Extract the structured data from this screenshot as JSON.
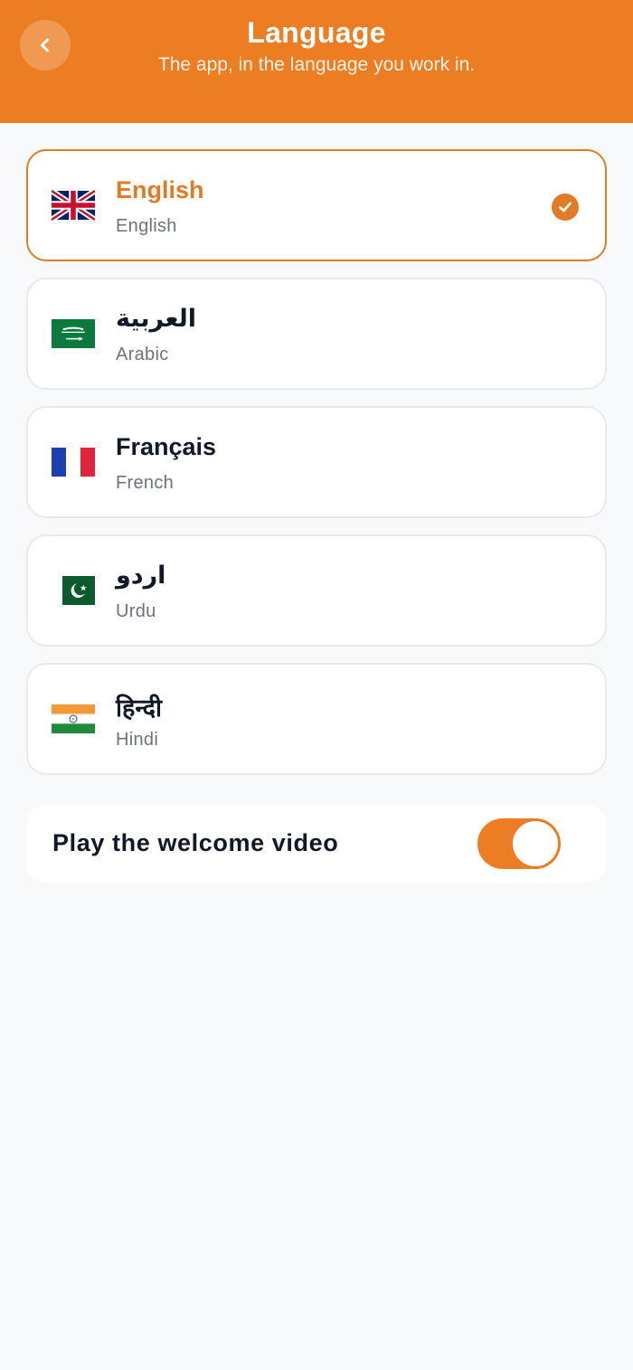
{
  "header": {
    "title": "Language",
    "subtitle": "The app, in the language you work in.",
    "back_icon": "chevron-left-icon",
    "color": "#ec7d22"
  },
  "languages": [
    {
      "name": "English",
      "subtitle": "English",
      "flag": "uk-flag-icon",
      "selected": true
    },
    {
      "name": "العربية",
      "subtitle": "Arabic",
      "flag": "saudi-flag-icon",
      "selected": false
    },
    {
      "name": "Français",
      "subtitle": "French",
      "flag": "france-flag-icon",
      "selected": false
    },
    {
      "name": "اردو",
      "subtitle": "Urdu",
      "flag": "pakistan-flag-icon",
      "selected": false
    },
    {
      "name": "हिन्दी",
      "subtitle": "Hindi",
      "flag": "india-flag-icon",
      "selected": false
    }
  ],
  "welcome_video": {
    "label": "Play the welcome video",
    "enabled": true
  },
  "colors": {
    "accent": "#e27b26",
    "text": "#111827",
    "muted": "#6b7280",
    "background": "#f8f9fb"
  }
}
